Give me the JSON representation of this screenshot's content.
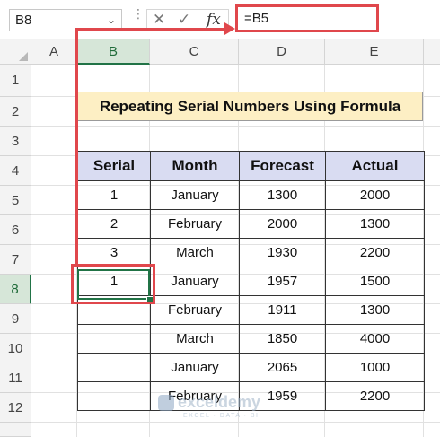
{
  "formula_bar": {
    "name_box": "B8",
    "cancel_icon": "✕",
    "enter_icon": "✓",
    "fx_label": "fx",
    "formula": "=B5"
  },
  "columns": [
    "A",
    "B",
    "C",
    "D",
    "E"
  ],
  "selected_column": "B",
  "rows": [
    "1",
    "2",
    "3",
    "4",
    "5",
    "6",
    "7",
    "8",
    "9",
    "10",
    "11",
    "12"
  ],
  "selected_row": "8",
  "title": "Repeating Serial Numbers Using Formula",
  "table": {
    "headers": [
      "Serial",
      "Month",
      "Forecast",
      "Actual"
    ],
    "rows": [
      [
        "1",
        "January",
        "1300",
        "2000"
      ],
      [
        "2",
        "February",
        "2000",
        "1300"
      ],
      [
        "3",
        "March",
        "1930",
        "2200"
      ],
      [
        "1",
        "January",
        "1957",
        "1500"
      ],
      [
        "",
        "February",
        "1911",
        "1300"
      ],
      [
        "",
        "March",
        "1850",
        "4000"
      ],
      [
        "",
        "January",
        "2065",
        "1000"
      ],
      [
        "",
        "February",
        "1959",
        "2200"
      ]
    ]
  },
  "watermark": {
    "name": "exceldemy",
    "tagline": "EXCEL · DATA · BI"
  },
  "colors": {
    "highlight": "#e0474c",
    "title_fill": "#fdefc4",
    "header_fill": "#d9dcf2",
    "selection": "#217346"
  }
}
